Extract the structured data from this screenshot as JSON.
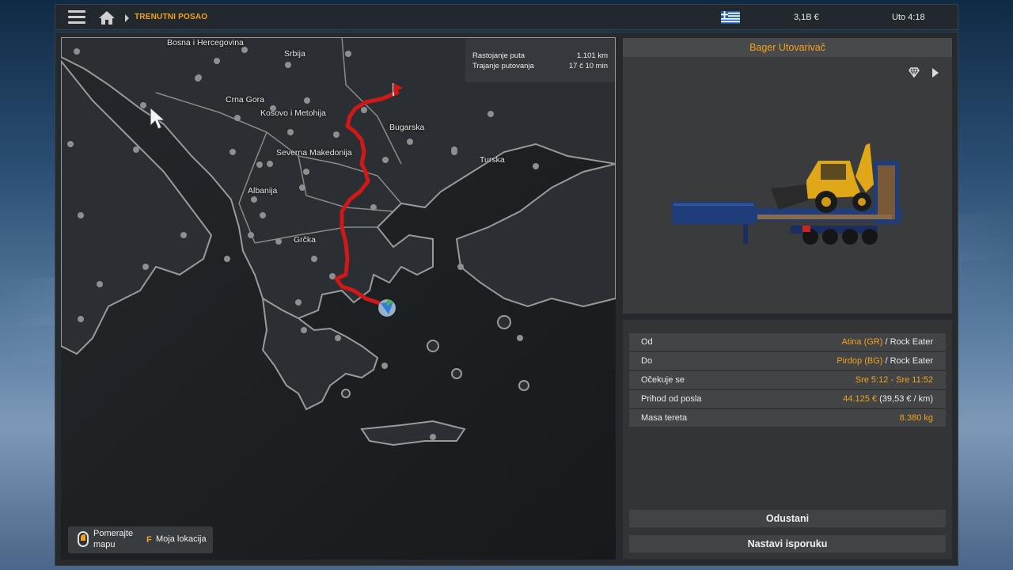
{
  "topbar": {
    "breadcrumb": "TRENUTNI POSAO",
    "money": "3,1B  €",
    "clock": "Uto 4:18",
    "icons": [
      "menu-icon",
      "home-icon",
      "greece-flag-icon"
    ]
  },
  "map": {
    "labels": {
      "bosna": "Bosna i Hercegovina",
      "srbija": "Srbija",
      "crna_gora": "Crna Gora",
      "kosovo": "Kosovo i Metohija",
      "bugarska": "Bugarska",
      "makedonija": "Severna Makedonija",
      "turska": "Turska",
      "albanija": "Albanija",
      "grcka": "Grčka"
    },
    "route_info": {
      "distance_label": "Rastojanje puta",
      "distance_value": "1.101 km",
      "duration_label": "Trajanje putovanja",
      "duration_value": "17 č 10 min"
    },
    "hint": {
      "pan_text_1": "Pomerajte",
      "pan_text_2": "mapu",
      "key": "F",
      "location_text": "Moja lokacija"
    }
  },
  "cargo": {
    "title": "Bager Utovarivač",
    "icons": [
      "diamond-icon",
      "next-arrow-icon"
    ]
  },
  "details": {
    "from": {
      "label": "Od",
      "city": "Atina (GR)",
      "company": " / Rock Eater"
    },
    "to": {
      "label": "Do",
      "city": "Pirdop (BG)",
      "company": " / Rock Eater"
    },
    "expected": {
      "label": "Očekuje se",
      "value": "Sre 5:12 - Sre 11:52"
    },
    "income": {
      "label": "Prihod od posla",
      "value": "44.125 €",
      "extra": " (39,53 € / km)"
    },
    "mass": {
      "label": "Masa tereta",
      "value": "8.380 kg"
    }
  },
  "buttons": {
    "cancel": "Odustani",
    "continue": "Nastavi isporuku"
  },
  "colors": {
    "accent": "#f2a31c",
    "route": "#d01818"
  }
}
